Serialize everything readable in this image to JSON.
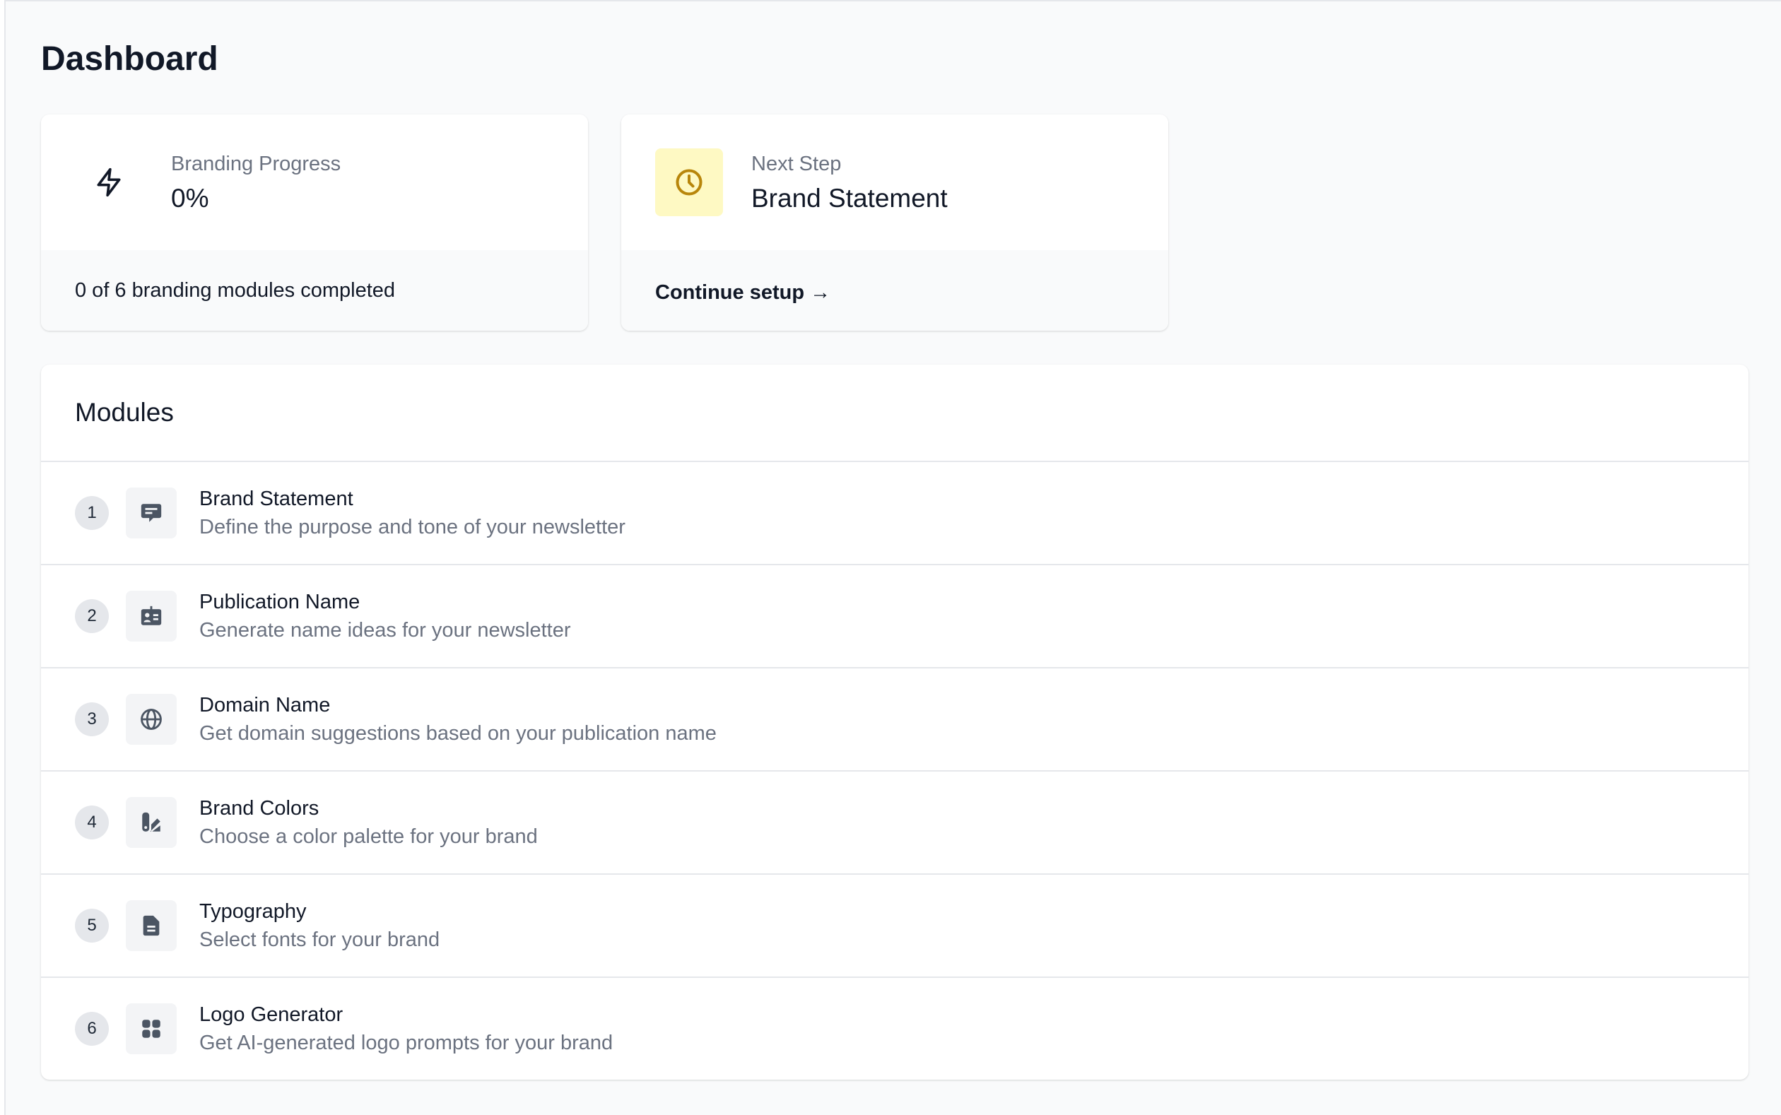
{
  "page": {
    "title": "Dashboard"
  },
  "progress_card": {
    "label": "Branding Progress",
    "value": "0%",
    "footer": "0 of 6 branding modules completed",
    "icon": "bolt-icon"
  },
  "next_step_card": {
    "label": "Next Step",
    "value": "Brand Statement",
    "link": "Continue setup →",
    "icon": "clock-icon",
    "icon_bg_color": "#fef9c3",
    "icon_color": "#b8860b"
  },
  "modules": {
    "title": "Modules",
    "items": [
      {
        "number": "1",
        "name": "Brand Statement",
        "description": "Define the purpose and tone of your newsletter",
        "icon": "chat-bubble-icon"
      },
      {
        "number": "2",
        "name": "Publication Name",
        "description": "Generate name ideas for your newsletter",
        "icon": "id-badge-icon"
      },
      {
        "number": "3",
        "name": "Domain Name",
        "description": "Get domain suggestions based on your publication name",
        "icon": "globe-icon"
      },
      {
        "number": "4",
        "name": "Brand Colors",
        "description": "Choose a color palette for your brand",
        "icon": "swatch-icon"
      },
      {
        "number": "5",
        "name": "Typography",
        "description": "Select fonts for your brand",
        "icon": "document-icon"
      },
      {
        "number": "6",
        "name": "Logo Generator",
        "description": "Get AI-generated logo prompts for your brand",
        "icon": "grid-icon"
      }
    ]
  }
}
